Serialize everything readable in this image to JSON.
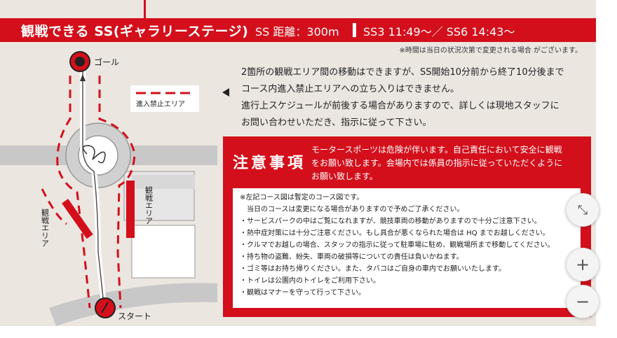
{
  "header": {
    "title": "観戦できる SS(ギャラリーステージ)",
    "distance": "SS 距離：300m",
    "schedule": "SS3 11:49〜／ SS6 14:43〜"
  },
  "time_note": "※時間は当日の状況次第で変更される場合 がございます。",
  "map": {
    "goal_label": "ゴール",
    "start_label": "スタート",
    "legend_label": "進入禁止エリア",
    "area_label_left": "観戦エリア",
    "area_label_right": "観戦エリア"
  },
  "notice_lines": [
    "2箇所の観戦エリア間の移動はできますが、SS開始10分前から終了10分後まで",
    "コース内進入禁止エリアへの立ち入りはできません。",
    "進行上スケジュールが前後する場合がありますので、詳しくは現地スタッフに",
    "お問い合わせいただき、指示に従って下さい。"
  ],
  "caution": {
    "title": "注意事項",
    "lines": [
      "モータースポーツは危険が伴います。自己責任において安全に観戦",
      "をお願い致します。会場内では係員の指示に従っていただくように",
      "お願い致します。"
    ]
  },
  "rules": [
    "※左記コース図は暫定のコース図です。",
    "　当日のコースは変更になる場合がありますので予めご了承ください。",
    "・サービスパークの中はご覧になれますが、競技車両の移動がありますので十分ご注意下さい。",
    "・熱中症対策には十分ご注意ください。もし具合が悪くなられた場合は HQ までお越しください。",
    "・クルマでお越しの場合、スタッフの指示に従って駐車場に駐め、観戦場所まで移動してください。",
    "・持ち物の盗難、紛失、車両の破損等についての責任は負いかねます。",
    "・ゴミ等はお持ち帰りください。また、タバコはご自身の車内でお願いいたします。",
    "・トイレは公園内のトイレをご利用下さい。",
    "・観戦はマナーを守って行って下さい。"
  ],
  "controls": {
    "fit_icon": "⤡",
    "zoom_in": "+",
    "zoom_out": "−"
  },
  "colors": {
    "accent_red": "#d30f1b",
    "background": "#ebe6e0",
    "road_gray": "#c8c8c8"
  }
}
